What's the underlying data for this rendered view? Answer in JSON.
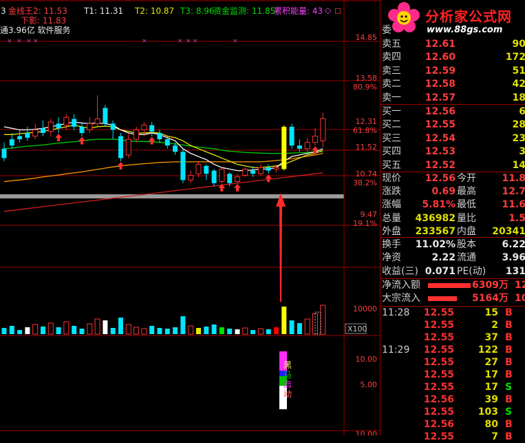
{
  "colors": {
    "up": "#ff3232",
    "down": "#00e5ff",
    "ma_white": "#ffffff",
    "ma_yellow": "#e8e800",
    "ma_green": "#00d000",
    "ma_orange": "#ff9900",
    "grid": "#a00000"
  },
  "header": {
    "first": "3",
    "jxw_label": "金线王2:",
    "jxw_value": "11.53",
    "t1": "T1: 11.31",
    "t2": "T2: 10.87",
    "t3": "T3: 8.96",
    "zjjc": "资金监测: 11.85",
    "ljnl": "累积能量: 43",
    "xiaying": "下影: 11.83",
    "info": "通3.96亿 软件服务"
  },
  "price_axis": {
    "ticks": [
      {
        "price": "14.85",
        "pct": ""
      },
      {
        "price": "13.58",
        "pct": "80.9%"
      },
      {
        "price": "12.31",
        "pct": "61.8%"
      },
      {
        "price": "11.52",
        "pct": ""
      },
      {
        "price": "10.74",
        "pct": "38.2%"
      },
      {
        "price": "9.47",
        "pct": "19.1%"
      }
    ]
  },
  "vol_axis": {
    "tick": "10000",
    "unit": "X100"
  },
  "ind_axis": {
    "ticks": [
      "10.00",
      "5.00",
      "10.00"
    ],
    "chars": [
      "黑",
      "马",
      "启",
      "动"
    ]
  },
  "logo": {
    "title": "分析家公式网",
    "url": "www.88gs.com"
  },
  "quote": {
    "weibi": "委",
    "asks": [
      {
        "label": "卖五",
        "price": "12.61",
        "vol": "90"
      },
      {
        "label": "卖四",
        "price": "12.60",
        "vol": "172"
      },
      {
        "label": "卖三",
        "price": "12.59",
        "vol": "51"
      },
      {
        "label": "卖二",
        "price": "12.58",
        "vol": "42"
      },
      {
        "label": "卖一",
        "price": "12.57",
        "vol": "18"
      }
    ],
    "bids": [
      {
        "label": "买一",
        "price": "12.56",
        "vol": "6"
      },
      {
        "label": "买二",
        "price": "12.55",
        "vol": "28"
      },
      {
        "label": "买三",
        "price": "12.54",
        "vol": "23"
      },
      {
        "label": "买四",
        "price": "12.53",
        "vol": "3"
      },
      {
        "label": "买五",
        "price": "12.52",
        "vol": "14"
      }
    ],
    "stats": [
      {
        "l1": "现价",
        "v1": "12.56",
        "l2": "今开",
        "v2": "11.8"
      },
      {
        "l1": "涨跌",
        "v1": "0.69",
        "l2": "最高",
        "v2": "12.7"
      },
      {
        "l1": "涨幅",
        "v1": "5.81%",
        "l2": "最低",
        "v2": "11.6"
      },
      {
        "l1": "总量",
        "v1": "436982",
        "l2": "量比",
        "v2": "1.5"
      },
      {
        "l1": "外盘",
        "v1": "233567",
        "l2": "内盘",
        "v2": "20341"
      }
    ],
    "stats2": [
      {
        "l1": "换手",
        "v1": "11.02%",
        "l2": "股本",
        "v2": "6.22"
      },
      {
        "l1": "净资",
        "v1": "2.22",
        "l2": "流通",
        "v2": "3.96"
      },
      {
        "l1": "收益(三)",
        "v1": "0.071",
        "l2": "PE(动)",
        "v2": "131"
      }
    ],
    "flows": [
      {
        "label": "净流入额",
        "value": "6309万",
        "extra": "12"
      },
      {
        "label": "大宗流入",
        "value": "5164万",
        "extra": "10"
      }
    ]
  },
  "trades": [
    {
      "time": "11:28",
      "price": "12.55",
      "vol": "15",
      "side": "B"
    },
    {
      "time": "",
      "price": "12.55",
      "vol": "2",
      "side": "B"
    },
    {
      "time": "",
      "price": "12.55",
      "vol": "37",
      "side": "B"
    },
    {
      "time": "11:29",
      "price": "12.55",
      "vol": "122",
      "side": "B"
    },
    {
      "time": "",
      "price": "12.55",
      "vol": "27",
      "side": "B"
    },
    {
      "time": "",
      "price": "12.55",
      "vol": "17",
      "side": "B"
    },
    {
      "time": "",
      "price": "12.55",
      "vol": "17",
      "side": "S"
    },
    {
      "time": "",
      "price": "12.56",
      "vol": "39",
      "side": "B"
    },
    {
      "time": "",
      "price": "12.55",
      "vol": "103",
      "side": "S"
    },
    {
      "time": "",
      "price": "12.56",
      "vol": "80",
      "side": "B"
    },
    {
      "time": "",
      "price": "12.55",
      "vol": "7",
      "side": "B"
    }
  ],
  "chart_data": {
    "type": "candlestick",
    "candles": [
      {
        "o": 11.6,
        "c": 11.3,
        "h": 11.8,
        "l": 11.2
      },
      {
        "o": 11.9,
        "c": 11.7,
        "h": 12.1,
        "l": 11.6
      },
      {
        "o": 12.0,
        "c": 11.9,
        "h": 12.2,
        "l": 11.8
      },
      {
        "o": 12.1,
        "c": 11.95,
        "h": 12.3,
        "l": 11.85
      },
      {
        "o": 12.0,
        "c": 12.2,
        "h": 12.4,
        "l": 11.9
      },
      {
        "o": 12.25,
        "c": 12.1,
        "h": 12.5,
        "l": 12.0
      },
      {
        "o": 12.15,
        "c": 12.45,
        "h": 12.55,
        "l": 12.0
      },
      {
        "o": 12.4,
        "c": 12.25,
        "h": 12.6,
        "l": 12.1
      },
      {
        "o": 12.35,
        "c": 12.6,
        "h": 12.7,
        "l": 12.2
      },
      {
        "o": 12.55,
        "c": 12.3,
        "h": 12.7,
        "l": 12.2
      },
      {
        "o": 12.3,
        "c": 12.1,
        "h": 12.45,
        "l": 12.0
      },
      {
        "o": 12.2,
        "c": 12.4,
        "h": 12.6,
        "l": 12.1
      },
      {
        "o": 12.4,
        "c": 12.55,
        "h": 13.3,
        "l": 12.3
      },
      {
        "o": 12.9,
        "c": 12.4,
        "h": 13.0,
        "l": 12.3
      },
      {
        "o": 12.4,
        "c": 12.2,
        "h": 12.5,
        "l": 11.9
      },
      {
        "o": 12.0,
        "c": 11.3,
        "h": 12.1,
        "l": 11.2
      },
      {
        "o": 11.4,
        "c": 11.9,
        "h": 12.1,
        "l": 11.3
      },
      {
        "o": 11.9,
        "c": 12.2,
        "h": 12.3,
        "l": 11.8
      },
      {
        "o": 12.2,
        "c": 12.35,
        "h": 12.45,
        "l": 12.0
      },
      {
        "o": 12.35,
        "c": 12.15,
        "h": 12.45,
        "l": 12.0
      },
      {
        "o": 12.1,
        "c": 11.9,
        "h": 12.2,
        "l": 11.8
      },
      {
        "o": 11.9,
        "c": 11.7,
        "h": 12.0,
        "l": 11.6
      },
      {
        "o": 11.7,
        "c": 11.5,
        "h": 11.8,
        "l": 11.4
      },
      {
        "o": 11.5,
        "c": 10.6,
        "h": 11.6,
        "l": 10.5
      },
      {
        "o": 10.6,
        "c": 10.75,
        "h": 10.9,
        "l": 10.5
      },
      {
        "o": 10.8,
        "c": 11.1,
        "h": 11.2,
        "l": 10.7
      },
      {
        "o": 11.05,
        "c": 10.8,
        "h": 11.1,
        "l": 10.6
      },
      {
        "o": 10.9,
        "c": 10.5,
        "h": 10.95,
        "l": 10.4
      },
      {
        "o": 10.55,
        "c": 10.95,
        "h": 11.0,
        "l": 10.5
      },
      {
        "o": 10.8,
        "c": 10.5,
        "h": 10.85,
        "l": 10.4
      },
      {
        "o": 10.55,
        "c": 10.7,
        "h": 10.8,
        "l": 10.5
      },
      {
        "o": 10.75,
        "c": 10.95,
        "h": 11.0,
        "l": 10.7
      },
      {
        "o": 10.9,
        "c": 10.8,
        "h": 11.05,
        "l": 10.7
      },
      {
        "o": 10.8,
        "c": 11.0,
        "h": 11.1,
        "l": 10.75
      },
      {
        "o": 11.0,
        "c": 10.9,
        "h": 11.1,
        "l": 10.8
      },
      {
        "o": 10.95,
        "c": 11.0,
        "h": 11.05,
        "l": 10.85
      },
      {
        "o": 10.95,
        "c": 12.3,
        "h": 12.35,
        "l": 10.9,
        "highlight": true
      },
      {
        "o": 12.3,
        "c": 11.7,
        "h": 12.4,
        "l": 11.6
      },
      {
        "o": 11.7,
        "c": 11.6,
        "h": 11.9,
        "l": 11.5
      },
      {
        "o": 11.6,
        "c": 11.8,
        "h": 11.95,
        "l": 11.5
      },
      {
        "o": 11.8,
        "c": 12.0,
        "h": 12.25,
        "l": 11.7
      },
      {
        "o": 11.85,
        "c": 12.56,
        "h": 12.75,
        "l": 11.65
      }
    ],
    "volumes": [
      9,
      12,
      6,
      10,
      14,
      11,
      16,
      10,
      18,
      12,
      8,
      15,
      22,
      20,
      9,
      24,
      14,
      10,
      8,
      12,
      9,
      8,
      10,
      26,
      12,
      9,
      11,
      14,
      10,
      8,
      7,
      9,
      6,
      8,
      7,
      10,
      40,
      20,
      16,
      22,
      30,
      42
    ],
    "ma_white": [
      12.3,
      12.25,
      12.2,
      12.2,
      12.22,
      12.25,
      12.3,
      12.35,
      12.4,
      12.45,
      12.42,
      12.4,
      12.42,
      12.4,
      12.35,
      12.2,
      12.1,
      12.05,
      12.05,
      12.1,
      12.05,
      11.95,
      11.85,
      11.6,
      11.45,
      11.35,
      11.25,
      11.1,
      11.0,
      10.95,
      10.9,
      10.9,
      10.92,
      10.95,
      10.95,
      11.0,
      11.2,
      11.35,
      11.4,
      11.45,
      11.5,
      11.6
    ],
    "ma_yellow": [
      12.05,
      12.05,
      12.08,
      12.1,
      12.12,
      12.15,
      12.2,
      12.25,
      12.3,
      12.35,
      12.3,
      12.25,
      12.3,
      12.32,
      12.3,
      12.2,
      12.15,
      12.1,
      12.1,
      12.12,
      12.1,
      12.0,
      11.95,
      11.85,
      11.7,
      11.6,
      11.5,
      11.4,
      11.3,
      11.2,
      11.1,
      11.05,
      11.0,
      11.0,
      11.02,
      11.05,
      11.1,
      11.2,
      11.3,
      11.4,
      11.45,
      11.55
    ],
    "ma_green": [
      11.6,
      11.62,
      11.65,
      11.68,
      11.7,
      11.72,
      11.75,
      11.78,
      11.8,
      11.82,
      11.85,
      11.88,
      11.9,
      11.9,
      11.9,
      11.88,
      11.85,
      11.83,
      11.83,
      11.82,
      11.8,
      11.78,
      11.75,
      11.72,
      11.68,
      11.65,
      11.62,
      11.6,
      11.55,
      11.52,
      11.5,
      11.48,
      11.47,
      11.46,
      11.45,
      11.45,
      11.45,
      11.46,
      11.47,
      11.48,
      11.5,
      11.5
    ],
    "ma_orange": [
      10.55,
      10.58,
      10.6,
      10.63,
      10.66,
      10.7,
      10.73,
      10.76,
      10.8,
      10.83,
      10.86,
      10.9,
      10.94,
      10.98,
      11.02,
      11.05,
      11.08,
      11.1,
      11.12,
      11.14,
      11.16,
      11.17,
      11.18,
      11.18,
      11.18,
      11.18,
      11.18,
      11.18,
      11.18,
      11.18,
      11.18,
      11.18,
      11.18,
      11.18,
      11.2,
      11.22,
      11.25,
      11.28,
      11.32,
      11.36,
      11.4,
      11.45
    ],
    "ma_red": [
      9.6,
      9.63,
      9.66,
      9.69,
      9.72,
      9.75,
      9.78,
      9.81,
      9.84,
      9.87,
      9.9,
      9.93,
      9.96,
      9.99,
      10.02,
      10.05,
      10.08,
      10.11,
      10.14,
      10.17,
      10.2,
      10.23,
      10.26,
      10.29,
      10.32,
      10.35,
      10.38,
      10.41,
      10.44,
      10.47,
      10.5,
      10.53,
      10.56,
      10.59,
      10.62,
      10.65,
      10.68,
      10.71,
      10.74,
      10.77,
      10.8,
      10.83
    ],
    "buy_arrows": [
      7,
      10,
      15,
      19,
      28,
      30,
      34,
      40
    ],
    "ylim": [
      9.2,
      15.2
    ]
  }
}
